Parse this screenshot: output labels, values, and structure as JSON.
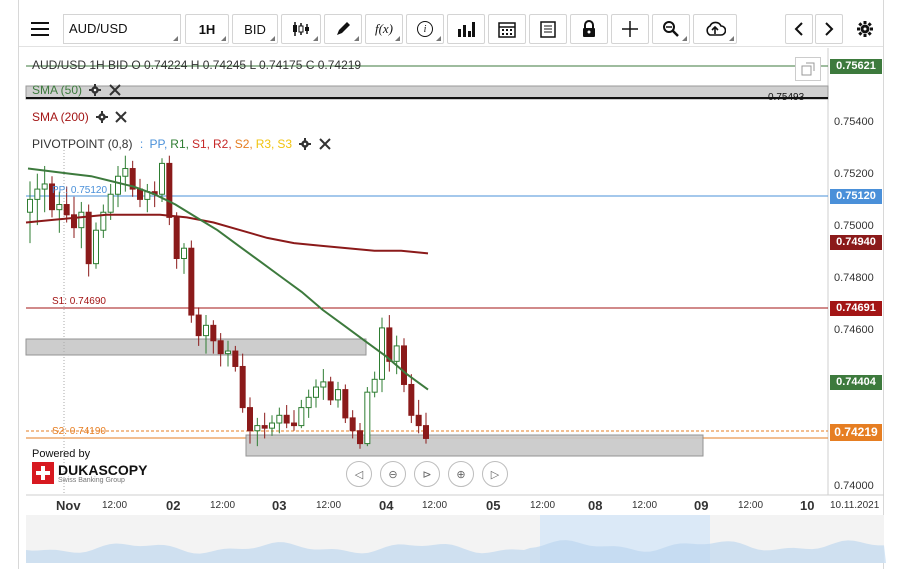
{
  "toolbar": {
    "symbol": "AUD/USD",
    "timeframe": "1H",
    "price_side": "BID",
    "fx_label": "f(x)",
    "info_label": "i"
  },
  "legend": {
    "ohlc": "AUD/USD 1H  BID  O  0.74224  H  0.74245  L  0.74175  C  0.74219",
    "sma50": "SMA (50)",
    "sma200": "SMA (200)",
    "pivot_label": "PIVOTPOINT (0,8)",
    "pivot_items": [
      {
        "label": "PP",
        "color": "#4a90d9"
      },
      {
        "label": "R1",
        "color": "#2e7d32"
      },
      {
        "label": "S1",
        "color": "#c62828"
      },
      {
        "label": "R2",
        "color": "#c62828"
      },
      {
        "label": "S2",
        "color": "#e67e22"
      },
      {
        "label": "R3",
        "color": "#f1c40f"
      },
      {
        "label": "S3",
        "color": "#f1c40f"
      }
    ]
  },
  "levels": {
    "r1_value": "0.75621",
    "sma50_band_value": "0.75493",
    "pp_label": "PP: 0.75120",
    "pp_value": "0.75120",
    "sma200_value": "0.74940",
    "s1_label": "S1: 0.74690",
    "s1_value": "0.74691",
    "sma50_value": "0.74404",
    "s2_label": "S2: 0.74190",
    "last_price": "0.74219"
  },
  "y_axis": [
    "0.75400",
    "0.75200",
    "0.75000",
    "0.74800",
    "0.74600",
    "0.74000"
  ],
  "x_axis": [
    {
      "label": "Nov",
      "bold": true
    },
    {
      "label": "12:00",
      "bold": false
    },
    {
      "label": "02",
      "bold": true
    },
    {
      "label": "12:00",
      "bold": false
    },
    {
      "label": "03",
      "bold": true
    },
    {
      "label": "12:00",
      "bold": false
    },
    {
      "label": "04",
      "bold": true
    },
    {
      "label": "12:00",
      "bold": false
    },
    {
      "label": "05",
      "bold": true
    },
    {
      "label": "12:00",
      "bold": false
    },
    {
      "label": "08",
      "bold": true
    },
    {
      "label": "12:00",
      "bold": false
    },
    {
      "label": "09",
      "bold": true
    },
    {
      "label": "12:00",
      "bold": false
    },
    {
      "label": "10",
      "bold": true
    },
    {
      "label": "10.11.2021",
      "bold": false
    }
  ],
  "branding": {
    "powered_by": "Powered by",
    "name": "DUKASCOPY",
    "tagline": "Swiss Banking Group"
  },
  "colors": {
    "up": "#2e7d32",
    "down": "#8b1a1a",
    "sma50": "#3d7a3d",
    "sma200": "#8b1a1a",
    "pp": "#4a90d9",
    "s1": "#a31515",
    "s2": "#e67e22",
    "r1": "#3d7a3d",
    "last": "#e67e22"
  },
  "chart_data": {
    "type": "candlestick",
    "ylim": [
      0.74,
      0.757
    ],
    "candles": [
      [
        0.751,
        0.7522,
        0.7498,
        0.7515
      ],
      [
        0.7515,
        0.7525,
        0.7505,
        0.7519
      ],
      [
        0.7519,
        0.7528,
        0.751,
        0.7521
      ],
      [
        0.7521,
        0.7524,
        0.7508,
        0.7511
      ],
      [
        0.7511,
        0.7518,
        0.7502,
        0.7513
      ],
      [
        0.7513,
        0.752,
        0.7506,
        0.7509
      ],
      [
        0.7509,
        0.7516,
        0.75,
        0.7504
      ],
      [
        0.7504,
        0.7514,
        0.7496,
        0.751
      ],
      [
        0.751,
        0.7513,
        0.7485,
        0.749
      ],
      [
        0.749,
        0.7506,
        0.7488,
        0.7503
      ],
      [
        0.7503,
        0.7513,
        0.75,
        0.751
      ],
      [
        0.751,
        0.7521,
        0.7507,
        0.7517
      ],
      [
        0.7517,
        0.7528,
        0.7512,
        0.7524
      ],
      [
        0.7524,
        0.7532,
        0.7518,
        0.7527
      ],
      [
        0.7527,
        0.753,
        0.7516,
        0.7519
      ],
      [
        0.7519,
        0.7523,
        0.7512,
        0.7515
      ],
      [
        0.7515,
        0.7521,
        0.751,
        0.7518
      ],
      [
        0.7518,
        0.7522,
        0.7512,
        0.7517
      ],
      [
        0.7517,
        0.7531,
        0.7514,
        0.7529
      ],
      [
        0.7529,
        0.7532,
        0.7505,
        0.7508
      ],
      [
        0.7508,
        0.751,
        0.7488,
        0.7492
      ],
      [
        0.7492,
        0.7498,
        0.7486,
        0.7496
      ],
      [
        0.7496,
        0.7499,
        0.7467,
        0.747
      ],
      [
        0.747,
        0.7473,
        0.7458,
        0.7462
      ],
      [
        0.7462,
        0.747,
        0.7455,
        0.7466
      ],
      [
        0.7466,
        0.7468,
        0.7455,
        0.746
      ],
      [
        0.746,
        0.7463,
        0.745,
        0.7455
      ],
      [
        0.7455,
        0.746,
        0.745,
        0.7456
      ],
      [
        0.7456,
        0.7458,
        0.7448,
        0.745
      ],
      [
        0.745,
        0.7455,
        0.7432,
        0.7434
      ],
      [
        0.7434,
        0.7438,
        0.742,
        0.7425
      ],
      [
        0.7425,
        0.743,
        0.7419,
        0.7427
      ],
      [
        0.7427,
        0.7432,
        0.7422,
        0.7426
      ],
      [
        0.7426,
        0.7431,
        0.7423,
        0.7428
      ],
      [
        0.7428,
        0.7434,
        0.7424,
        0.7431
      ],
      [
        0.7431,
        0.7435,
        0.7426,
        0.7428
      ],
      [
        0.7428,
        0.7433,
        0.7425,
        0.7427
      ],
      [
        0.7427,
        0.7437,
        0.7426,
        0.7434
      ],
      [
        0.7434,
        0.7441,
        0.743,
        0.7438
      ],
      [
        0.7438,
        0.7445,
        0.7434,
        0.7442
      ],
      [
        0.7442,
        0.7449,
        0.7437,
        0.7444
      ],
      [
        0.7444,
        0.7446,
        0.7435,
        0.7437
      ],
      [
        0.7437,
        0.7444,
        0.7434,
        0.7441
      ],
      [
        0.7441,
        0.7443,
        0.7428,
        0.743
      ],
      [
        0.743,
        0.7433,
        0.7422,
        0.7425
      ],
      [
        0.7425,
        0.7428,
        0.7418,
        0.742
      ],
      [
        0.742,
        0.7442,
        0.7419,
        0.744
      ],
      [
        0.744,
        0.7448,
        0.7438,
        0.7445
      ],
      [
        0.7445,
        0.7469,
        0.744,
        0.7465
      ],
      [
        0.7465,
        0.747,
        0.7448,
        0.7452
      ],
      [
        0.7452,
        0.7462,
        0.7447,
        0.7458
      ],
      [
        0.7458,
        0.7461,
        0.744,
        0.7443
      ],
      [
        0.7443,
        0.7447,
        0.7428,
        0.7431
      ],
      [
        0.7431,
        0.7437,
        0.7424,
        0.7427
      ],
      [
        0.7427,
        0.7432,
        0.742,
        0.7422
      ]
    ],
    "sma50_values": [
      0.7527,
      0.7526,
      0.7525,
      0.7524,
      0.7522,
      0.752,
      0.7517,
      0.7513,
      0.7508,
      0.7503,
      0.7497,
      0.7491,
      0.7485,
      0.7479,
      0.7472,
      0.7466,
      0.746,
      0.7454,
      0.7447,
      0.7441
    ],
    "sma200_values": [
      0.7506,
      0.7507,
      0.7508,
      0.7509,
      0.7509,
      0.7509,
      0.7508,
      0.7506,
      0.7503,
      0.75,
      0.7498,
      0.7497,
      0.7496,
      0.7495,
      0.7495,
      0.7494
    ]
  }
}
